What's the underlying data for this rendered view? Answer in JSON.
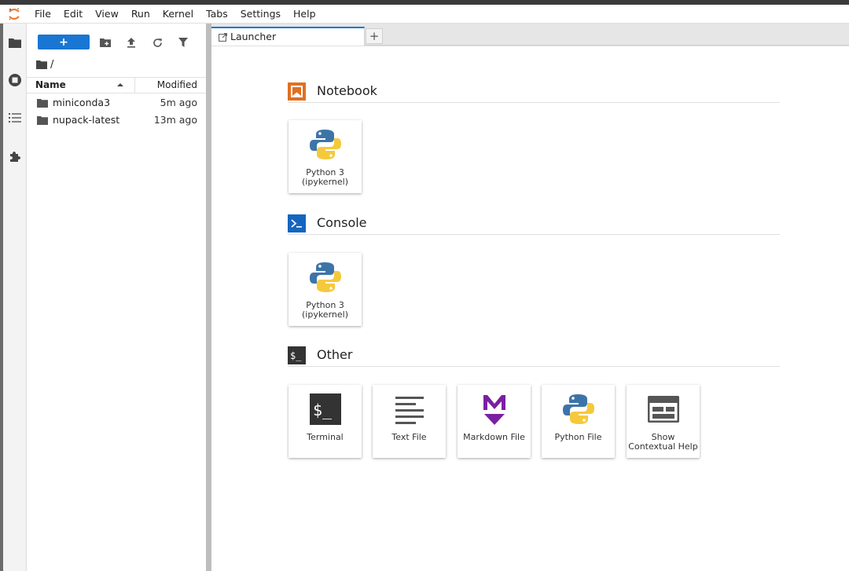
{
  "menubar": {
    "items": [
      "File",
      "Edit",
      "View",
      "Run",
      "Kernel",
      "Tabs",
      "Settings",
      "Help"
    ]
  },
  "filebrowser": {
    "new_label": "+",
    "path": "/",
    "columns": {
      "name": "Name",
      "modified": "Modified"
    },
    "files": [
      {
        "name": "miniconda3",
        "modified": "5m ago"
      },
      {
        "name": "nupack-latest",
        "modified": "13m ago"
      }
    ]
  },
  "tabs": {
    "active": "Launcher",
    "add_label": "+"
  },
  "launcher": {
    "sections": [
      {
        "title": "Notebook",
        "cards": [
          {
            "label": "Python 3 (ipykernel)"
          }
        ]
      },
      {
        "title": "Console",
        "cards": [
          {
            "label": "Python 3 (ipykernel)"
          }
        ]
      },
      {
        "title": "Other",
        "cards": [
          {
            "label": "Terminal"
          },
          {
            "label": "Text File"
          },
          {
            "label": "Markdown File"
          },
          {
            "label": "Python File"
          },
          {
            "label": "Show Contextual Help"
          }
        ]
      }
    ]
  },
  "colors": {
    "accent": "#1976d2",
    "notebook_orange": "#e07020",
    "console_blue": "#1565c0",
    "markdown_purple": "#7b1fa2",
    "terminal_dark": "#333333"
  },
  "icons": {
    "activity": [
      "folder-icon",
      "running-icon",
      "toc-icon",
      "extension-icon"
    ],
    "toolbar": [
      "new-folder-icon",
      "upload-icon",
      "refresh-icon",
      "filter-icon"
    ]
  }
}
